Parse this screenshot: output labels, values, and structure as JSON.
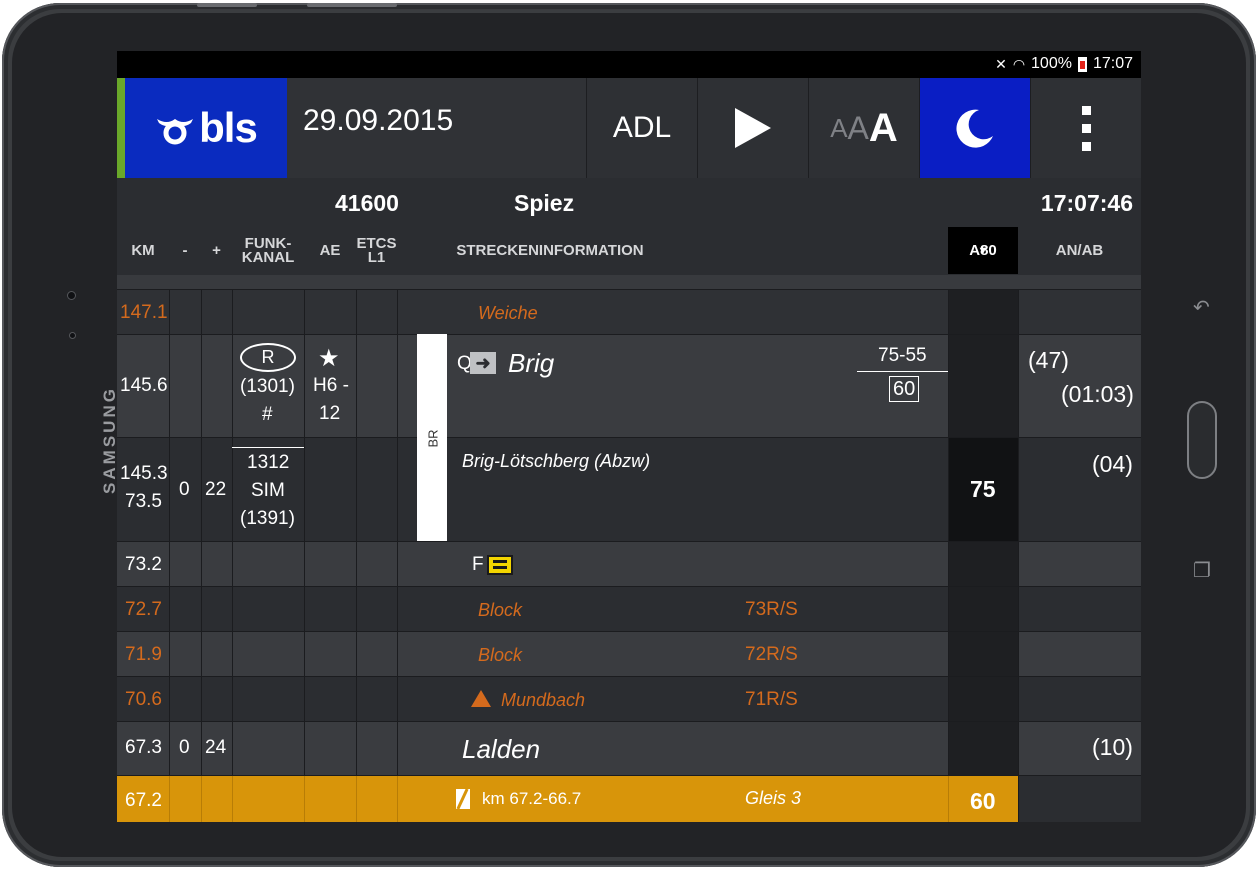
{
  "device": {
    "brand": "SAMSUNG"
  },
  "statusbar": {
    "mute": "🔇",
    "wifi": "📶",
    "battery": "100%",
    "time": "17:07"
  },
  "toolbar": {
    "logo": "bls",
    "date": "29.09.2015",
    "adl_label": "ADL",
    "play_icon": "play-icon",
    "font_sizes": [
      "A",
      "A",
      "A"
    ],
    "night_icon": "moon-icon",
    "menu_icon": "overflow-menu-icon"
  },
  "info": {
    "train_number": "41600",
    "station": "Spiez",
    "clock": "17:07:46"
  },
  "columns": {
    "km": "KM",
    "minus": "-",
    "plus": "+",
    "funk_line1": "FUNK-",
    "funk_line2": "KANAL",
    "ae": "AE",
    "etcs_line1": "ETCS",
    "etcs_line2": "L1",
    "strecke": "STRECKENINFORMATION",
    "a80": "A80",
    "anab": "AN/AB"
  },
  "rows": {
    "r1": {
      "km": "147.1",
      "info": "Weiche"
    },
    "r2": {
      "km": "145.6",
      "funk_ring": "R",
      "funk_line2": "(1301)",
      "funk_line3": "#",
      "ae_star": "★",
      "ae_line1": "H6 -",
      "ae_line2": "12",
      "q_label": "Q",
      "q_arrow": "➜",
      "station": "Brig",
      "speed_top": "75-55",
      "speed_box": "60",
      "anab_top": "(47)",
      "anab_bottom": "(01:03)"
    },
    "r3": {
      "km1": "145.3",
      "km2": "73.5",
      "minus": "0",
      "plus": "22",
      "funk1": "1312",
      "funk2": "SIM",
      "funk3": "(1391)",
      "info": "Brig-Lötschberg (Abzw)",
      "speed": "75",
      "anab": "(04)"
    },
    "br_label": "BR",
    "r4": {
      "km": "73.2",
      "info_prefix": "F"
    },
    "r5": {
      "km": "72.7",
      "info": "Block",
      "signal": "73R/S"
    },
    "r6": {
      "km": "71.9",
      "info": "Block",
      "signal": "72R/S"
    },
    "r7": {
      "km": "70.6",
      "info": "Mundbach",
      "signal": "71R/S"
    },
    "r8": {
      "km": "67.3",
      "minus": "0",
      "plus": "24",
      "station": "Lalden",
      "anab": "(10)"
    },
    "r9": {
      "km": "67.2",
      "info": "km 67.2-66.7",
      "track": "Gleis 3",
      "speed": "60"
    }
  }
}
